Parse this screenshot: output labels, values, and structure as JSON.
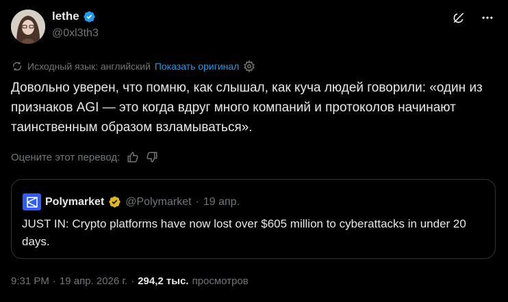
{
  "author": {
    "name": "lethe",
    "handle": "@0xl3th3",
    "verified": true
  },
  "translation": {
    "source_language_text": "Исходный язык: английский",
    "show_original": "Показать оригинал"
  },
  "tweet": {
    "text": "Довольно уверен, что помню, как слышал, как куча людей говорили: «один из признаков AGI — это когда вдруг много компаний и протоколов начинают таинственным образом взламываться»."
  },
  "rate": {
    "label": "Оцените этот перевод:"
  },
  "quote": {
    "name": "Polymarket",
    "handle": "@Polymarket",
    "separator": "·",
    "date": "19 апр.",
    "text": "JUST IN: Crypto platforms have now lost over $605 million to cyberattacks in under 20 days."
  },
  "footer": {
    "time": "9:31 PM",
    "separator1": "·",
    "date": "19 апр. 2026 г.",
    "separator2": "·",
    "views_count": "294,2 тыс.",
    "views_label": "просмотров"
  },
  "colors": {
    "accent": "#1d9bf0",
    "gold": "#e2b719",
    "polymarket_blue": "#2e5cff",
    "muted": "#71767b",
    "text": "#e7e9ea",
    "border": "#2f3336"
  }
}
